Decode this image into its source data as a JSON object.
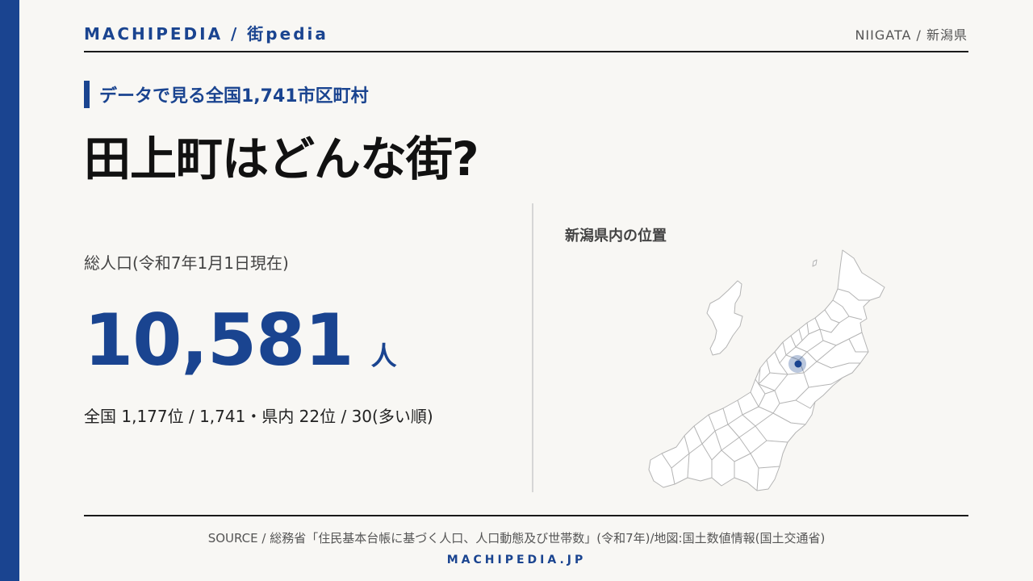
{
  "header": {
    "brand": "MACHIPEDIA / 街pedia",
    "region": "NIIGATA / 新潟県"
  },
  "hero": {
    "subtitle": "データで見る全国1,741市区町村",
    "title": "田上町はどんな街?"
  },
  "stat": {
    "label": "総人口(令和7年1月1日現在)",
    "value": "10,581",
    "unit": "人",
    "rank": "全国 1,177位 / 1,741・県内 22位 / 30(多い順)"
  },
  "map": {
    "title": "新潟県内の位置",
    "highlight_color": "#1a4490"
  },
  "footer": {
    "source": "SOURCE / 総務省「住民基本台帳に基づく人口、人口動態及び世帯数」(令和7年)/地図:国土数値情報(国土交通省)",
    "brand": "MACHIPEDIA.JP"
  },
  "colors": {
    "accent": "#1a4490",
    "background": "#f8f7f4"
  }
}
